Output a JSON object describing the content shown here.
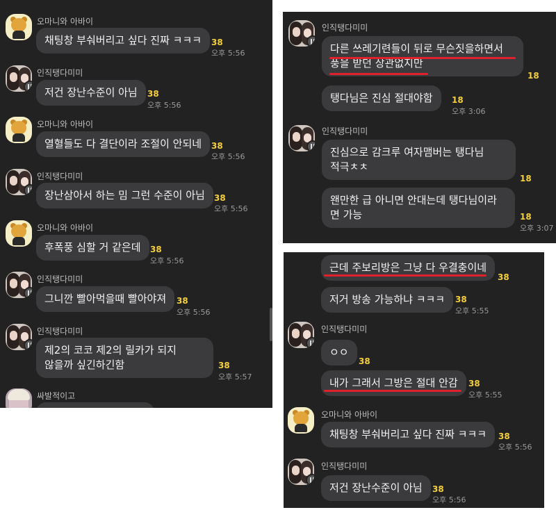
{
  "names": {
    "a": "오마니와 아바이",
    "b": "인직탱다미미",
    "c": "싸발적이고"
  },
  "panel1": {
    "messages": [
      {
        "text": "채팅창 부숴버리고 싶다 진짜 ㅋㅋㅋ",
        "count": "38",
        "time": "오후 5:56"
      },
      {
        "text": "저건 장난수준이 아님",
        "count": "38",
        "time": "오후 5:56"
      },
      {
        "text": "열혈들도 다 결단이라 조절이 안되네",
        "count": "38",
        "time": "오후 5:56"
      },
      {
        "text": "장난삼아서 하는 밈 그런 수준이 아님",
        "count": "38",
        "time": "오후 5:56"
      },
      {
        "text": "후폭풍 심할 거 같은데",
        "count": "38",
        "time": "오후 5:56"
      },
      {
        "text": "그니깐 빨아먹을때 빨아야져",
        "count": "38",
        "time": "오후 5:56"
      },
      {
        "text": "제2의 코코 제2의 릴카가 되지 않을까 싶긴하긴함",
        "count": "38",
        "time": "오후 5:57"
      }
    ]
  },
  "panel2": {
    "messages": [
      {
        "text": "다른 쓰레기련들이 뒤로 무슨짓을하면서 풍을 받던 상관없지만",
        "count": "18"
      },
      {
        "text": "탱다님은 진심 절대야함",
        "count": "18",
        "time": "오후 3:06"
      },
      {
        "text": "진심으로 감크루 여자맴버는 탱다님 적극ㅊㅊ",
        "count": "18"
      },
      {
        "text": "왠만한 급 아니면 안대는데 탱다님이라 면 가능",
        "count": "18",
        "time": "오후 3:07"
      }
    ]
  },
  "panel3": {
    "messages": [
      {
        "text": "근데 주보리방은 그냥 다 우결충이네",
        "count": "38"
      },
      {
        "text": "저거 방송 가능하냐 ㅋㅋㅋ",
        "count": "38",
        "time": "오후 5:55"
      },
      {
        "text": "ㅇㅇ",
        "count": "38"
      },
      {
        "text": "내가 그래서 그방은 절대 안감",
        "count": "38",
        "time": "오후 5:55"
      },
      {
        "text": "채팅창 부숴버리고 싶다 진짜 ㅋㅋㅋ",
        "count": "38",
        "time": "오후 5:56"
      },
      {
        "text": "저건 장난수준이 아님",
        "count": "38",
        "time": "오후 5:56"
      }
    ]
  },
  "colors": {
    "background": "#222223",
    "bubble": "#3b3b3d",
    "count": "#f4cf3a",
    "underline": "#e0202c"
  },
  "icons": {
    "avatar_a": "ryan-bear-avatar",
    "avatar_b": "profile-photo-avatar",
    "badge": "pause-badge-icon"
  }
}
